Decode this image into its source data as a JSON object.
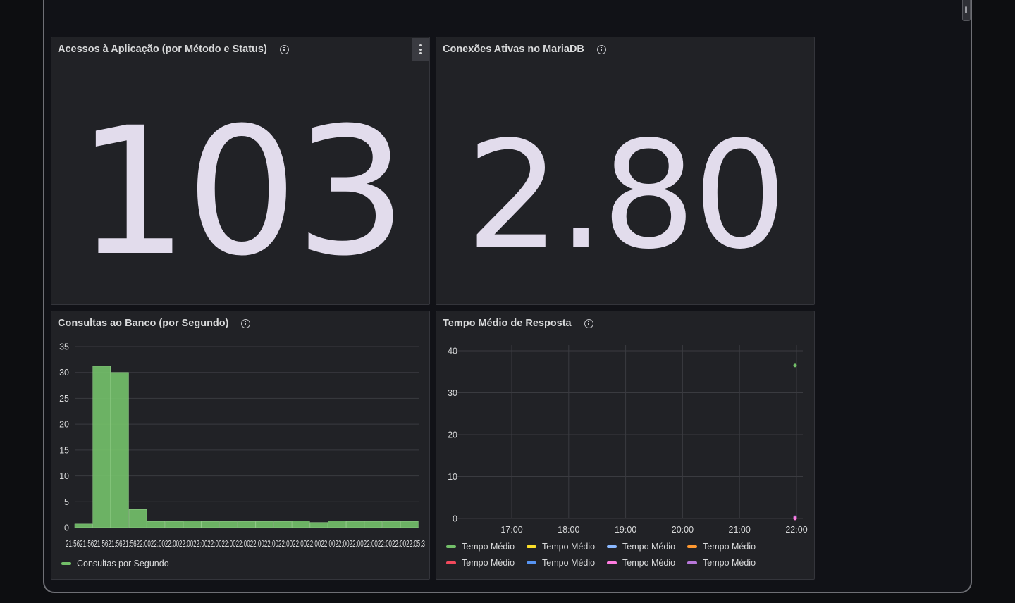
{
  "panels": {
    "acessos": {
      "title": "Acessos à Aplicação (por Método e Status)",
      "value": "103"
    },
    "conexoes": {
      "title": "Conexões Ativas no MariaDB",
      "value": "2.80"
    },
    "consultas": {
      "title": "Consultas ao Banco (por Segundo)"
    },
    "tempo": {
      "title": "Tempo Médio de Resposta"
    }
  },
  "icons": {
    "info": "info-circle-icon",
    "menu": "vertical-ellipsis-icon"
  },
  "colors": {
    "green": "#73bf69",
    "yellow": "#fade2a",
    "blue": "#8ab8ff",
    "orange": "#ff9830",
    "red": "#f2495c",
    "blue2": "#5794f2",
    "pink": "#ff7ce0",
    "purple": "#b877d9"
  },
  "chart_data": [
    {
      "type": "bar",
      "yticks": [
        "0",
        "5",
        "10",
        "15",
        "20",
        "25",
        "30",
        "35"
      ],
      "ylim": [
        0,
        35
      ],
      "xtick_text": "21:5621:5621:5621:5621:5622:0022:0022:0022:0022:0022:0022:0022:0022:0022:0022:0022:0022:0022:0022:0022:0022:0022:0022:0022:05:3",
      "values": [
        0.7,
        31.2,
        30,
        3.5,
        1.2,
        1.2,
        1.3,
        1.2,
        1.2,
        1.2,
        1.2,
        1.2,
        1.3,
        1.0,
        1.3,
        1.2,
        1.2,
        1.2,
        1.2
      ],
      "series_name": "Consultas por Segundo",
      "color": "#73bf69",
      "grid": true
    },
    {
      "type": "scatter",
      "yticks": [
        "0",
        "10",
        "20",
        "30",
        "40"
      ],
      "ylim": [
        0,
        40
      ],
      "xticks": [
        "17:00",
        "18:00",
        "19:00",
        "20:00",
        "21:00",
        "22:00"
      ],
      "points": [
        {
          "x": "22:00",
          "y": 36.5,
          "color": "#73bf69"
        },
        {
          "x": "22:00",
          "y": 0.3,
          "color": "#b877d9"
        },
        {
          "x": "22:00",
          "y": 0,
          "color": "#ff7ce0"
        }
      ],
      "legend": [
        {
          "name": "Tempo Médio",
          "color": "#73bf69"
        },
        {
          "name": "Tempo Médio",
          "color": "#fade2a"
        },
        {
          "name": "Tempo Médio",
          "color": "#8ab8ff"
        },
        {
          "name": "Tempo Médio",
          "color": "#ff9830"
        },
        {
          "name": "Tempo Médio",
          "color": "#f2495c"
        },
        {
          "name": "Tempo Médio",
          "color": "#5794f2"
        },
        {
          "name": "Tempo Médio",
          "color": "#ff7ce0"
        },
        {
          "name": "Tempo Médio",
          "color": "#b877d9"
        }
      ],
      "grid": true
    }
  ]
}
